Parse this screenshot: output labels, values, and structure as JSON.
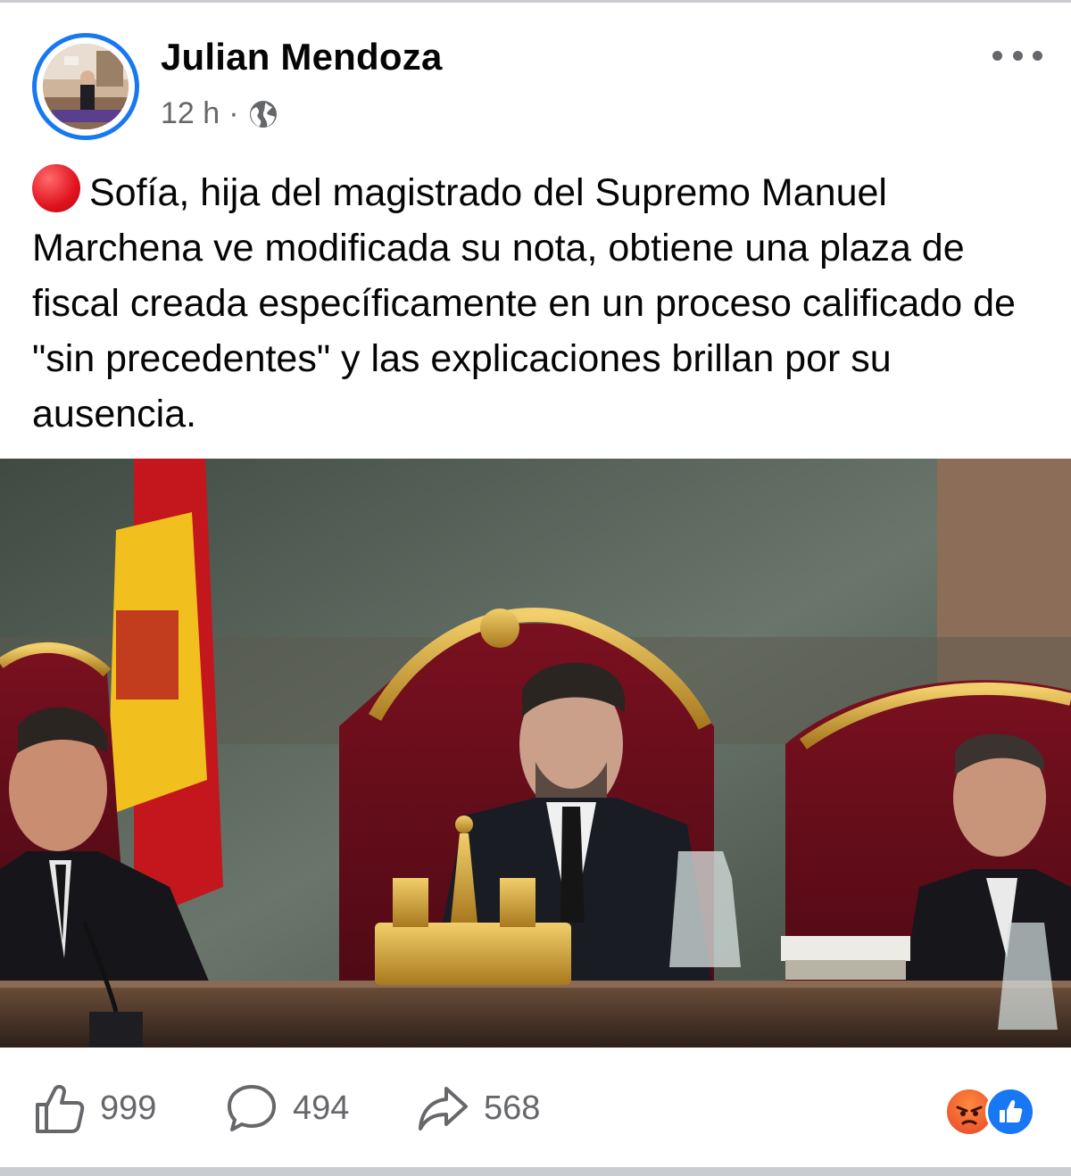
{
  "post": {
    "author": "Julian Mendoza",
    "time": "12 h",
    "separator": "·",
    "visibility_icon": "globe-icon",
    "more_icon": "more-options-icon",
    "status_icon": "red-circle-emoji",
    "text": "Sofía, hija del magistrado del Supremo Manuel Marchena ve modificada su nota, obtiene una plaza de fiscal creada específicamente en un proceso calificado de \"sin precedentes\" y las explicaciones brillan por su ausencia."
  },
  "actions": {
    "likes": "999",
    "comments": "494",
    "shares": "568"
  },
  "reactions": [
    "angry",
    "like"
  ],
  "colors": {
    "accent": "#1877f2",
    "secondary_text": "#65676b",
    "angry": "#f0642d",
    "like": "#1877f2"
  }
}
